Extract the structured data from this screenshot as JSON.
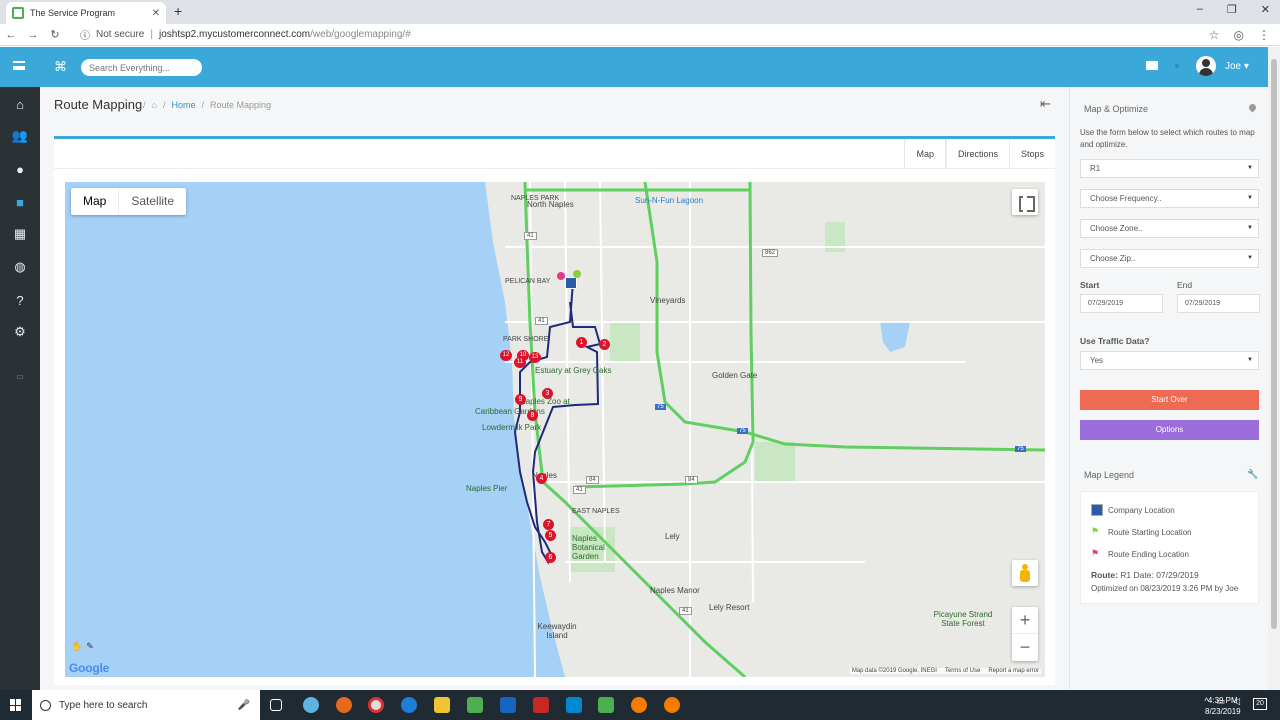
{
  "browser": {
    "tab_title": "The Service Program",
    "not_secure": "Not secure",
    "url_host": "joshtsp2.mycustomerconnect.com",
    "url_path": "/web/googlemapping/#"
  },
  "header": {
    "search_placeholder": "Search Everything...",
    "user_name": "Joe"
  },
  "page": {
    "title": "Route Mapping",
    "breadcrumb_home": "Home",
    "breadcrumb_current": "Route Mapping"
  },
  "tabs": [
    "Map",
    "Directions",
    "Stops"
  ],
  "map": {
    "type_map": "Map",
    "type_satellite": "Satellite",
    "google": "Google",
    "attribution": "Map data ©2019 Google, INEGI",
    "terms": "Terms of Use",
    "report": "Report a map error",
    "places": {
      "naples_park": "NAPLES PARK",
      "north_naples": "North Naples",
      "sun_n_fun": "Sun-N-Fun Lagoon",
      "pelican_bay": "PELICAN BAY",
      "vineyards": "Vineyards",
      "park_shore": "PARK SHORE",
      "estuary": "Estuary at Grey Oaks",
      "golden_gate": "Golden Gate",
      "naples_zoo": "Naples Zoo at",
      "caribbean_gardens": "Caribbean Gardens",
      "lowdermilk": "Lowdermilk Park",
      "naples": "Naples",
      "naples_pier": "Naples Pier",
      "east_naples": "EAST NAPLES",
      "naples_botanical": "Naples Botanical Garden",
      "lely": "Lely",
      "naples_manor": "Naples Manor",
      "lely_resort": "Lely Resort",
      "keewaydin": "Keewaydin Island",
      "picayune": "Picayune Strand State Forest"
    },
    "shields": [
      "41",
      "41",
      "862",
      "75",
      "75",
      "75",
      "84",
      "84",
      "41",
      "41"
    ],
    "stops": [
      "1",
      "2",
      "3",
      "4",
      "5",
      "6",
      "7",
      "8",
      "9",
      "10",
      "11",
      "12",
      "13"
    ]
  },
  "sidebar_right": {
    "title": "Map & Optimize",
    "description": "Use the form below to select which routes to map and optimize.",
    "route_value": "R1",
    "frequency": "Choose Frequency..",
    "zone": "Choose Zone..",
    "zip": "Choose Zip..",
    "start_label": "Start",
    "end_label": "End",
    "start_value": "07/29/2019",
    "end_value": "07/29/2019",
    "traffic_label": "Use Traffic Data?",
    "traffic_value": "Yes",
    "start_over": "Start Over",
    "options": "Options",
    "legend_title": "Map Legend",
    "legend_company": "Company Location",
    "legend_start": "Route Starting Location",
    "legend_end": "Route Ending Location",
    "route_label": "Route:",
    "route_text": "R1 Date: 07/29/2019",
    "optimized": "Optimized on 08/23/2019 3:26 PM by Joe"
  },
  "taskbar": {
    "search": "Type here to search",
    "time": "4:39 PM",
    "date": "8/23/2019",
    "notifications": "20"
  },
  "colors": {
    "header": "#3aa9d9",
    "sidebar": "#2b3236",
    "start_over": "#ee6a55",
    "options": "#9a6ddb",
    "route": "#1f2a7a",
    "marker": "#d9142b"
  }
}
